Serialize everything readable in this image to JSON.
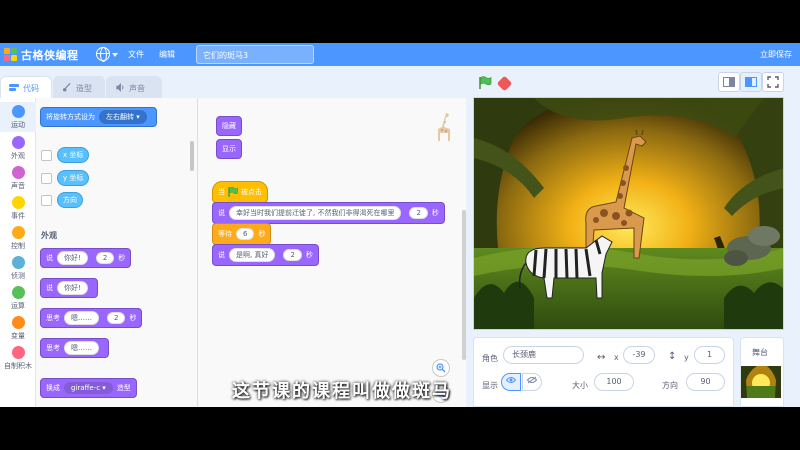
{
  "menubar": {
    "logo_text": "古格侠编程",
    "file": "文件",
    "edit": "编辑",
    "project_title": "它们的斑马3",
    "save_now": "立即保存"
  },
  "tabs": [
    {
      "label": "代码"
    },
    {
      "label": "造型"
    },
    {
      "label": "声音"
    }
  ],
  "categories": [
    {
      "label": "运动",
      "color": "#4c97ff"
    },
    {
      "label": "外观",
      "color": "#9966ff"
    },
    {
      "label": "声音",
      "color": "#cf63cf"
    },
    {
      "label": "事件",
      "color": "#ffd500"
    },
    {
      "label": "控制",
      "color": "#ffab19"
    },
    {
      "label": "侦测",
      "color": "#5cb1d6"
    },
    {
      "label": "运算",
      "color": "#59c059"
    },
    {
      "label": "变量",
      "color": "#ff8c1a"
    },
    {
      "label": "自制积木",
      "color": "#ff6680"
    }
  ],
  "palette": {
    "rotation_block": "将旋转方式设为",
    "rotation_value": "左右翻转",
    "x_pos": "x 坐标",
    "y_pos": "y 坐标",
    "direction": "方向",
    "looks_header": "外观",
    "say_for": {
      "label": "说",
      "text": "你好!",
      "secs": "2",
      "unit": "秒"
    },
    "say": {
      "label": "说",
      "text": "你好!"
    },
    "think_for": {
      "label": "思考",
      "text": "嗯……",
      "secs": "2",
      "unit": "秒"
    },
    "think": {
      "label": "思考",
      "text": "嗯……"
    },
    "switch_costume": {
      "label": "换成",
      "value": "giraffe-c",
      "suffix": "造型"
    }
  },
  "script_blocks": {
    "hide": "隐藏",
    "show": "显示",
    "when_flag": {
      "pre": "当",
      "post": "被点击"
    },
    "say1": {
      "label": "说",
      "text": "幸好当时我们提前迁徙了, 不然我们非得渴死在哪里",
      "secs": "2",
      "unit": "秒"
    },
    "wait": {
      "label": "等待",
      "secs": "6",
      "unit": "秒"
    },
    "say2": {
      "label": "说",
      "text": "是啊, 真好",
      "secs": "2",
      "unit": "秒"
    }
  },
  "sprite_info": {
    "sprite_label": "角色",
    "sprite_name": "长颈鹿",
    "x_label": "x",
    "x_value": "-39",
    "y_label": "y",
    "y_value": "1",
    "show_label": "显示",
    "size_label": "大小",
    "size_value": "100",
    "direction_label": "方向",
    "direction_value": "90"
  },
  "stage_panel": {
    "label": "舞台"
  },
  "subtitle": "这节课的课程叫做做斑马"
}
